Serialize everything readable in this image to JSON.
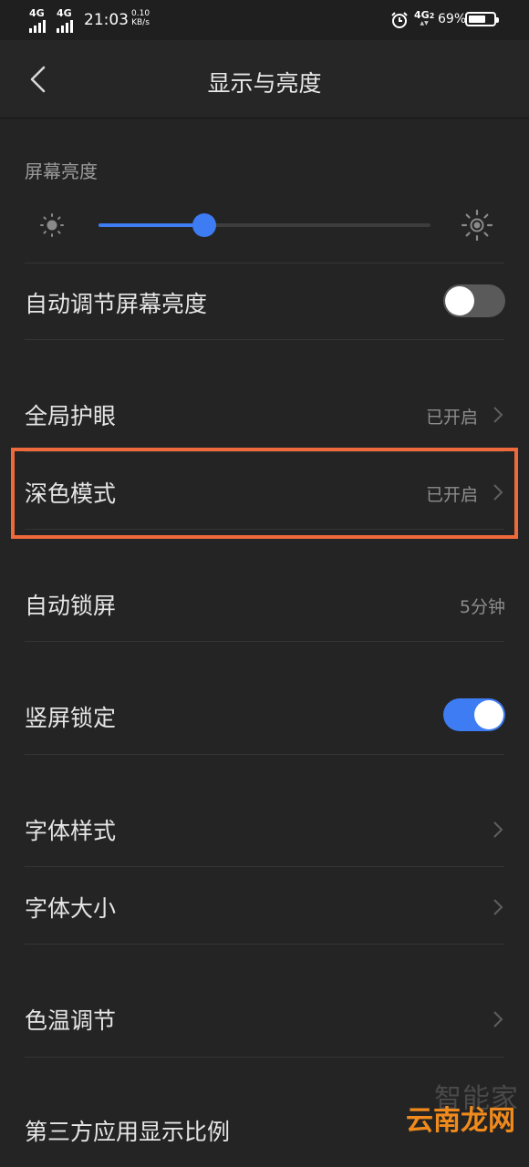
{
  "status_bar": {
    "signal_1": "4G",
    "signal_2": "4G",
    "time": "21:03",
    "speed_value": "0.10",
    "speed_unit": "KB/s",
    "network": "4G",
    "network_sub": "2",
    "battery_percent": "69%",
    "battery_level": 0.69
  },
  "header": {
    "title": "显示与亮度",
    "back_icon": "chevron-left-icon"
  },
  "brightness": {
    "section_label": "屏幕亮度",
    "level": 0.32,
    "accent_color": "#3d7cf2"
  },
  "settings": {
    "auto_brightness": {
      "label": "自动调节屏幕亮度",
      "enabled": false
    },
    "eye_protection": {
      "label": "全局护眼",
      "value": "已开启"
    },
    "dark_mode": {
      "label": "深色模式",
      "value": "已开启"
    },
    "auto_lock": {
      "label": "自动锁屏",
      "value": "5分钟"
    },
    "portrait_lock": {
      "label": "竖屏锁定",
      "enabled": true
    },
    "font_style": {
      "label": "字体样式"
    },
    "font_size": {
      "label": "字体大小"
    },
    "color_temp": {
      "label": "色温调节"
    },
    "third_party_ratio": {
      "label": "第三方应用显示比例"
    }
  },
  "highlight_color": "#ef6a3a",
  "watermark": {
    "top": "智能家",
    "bottom": "云南龙网"
  }
}
